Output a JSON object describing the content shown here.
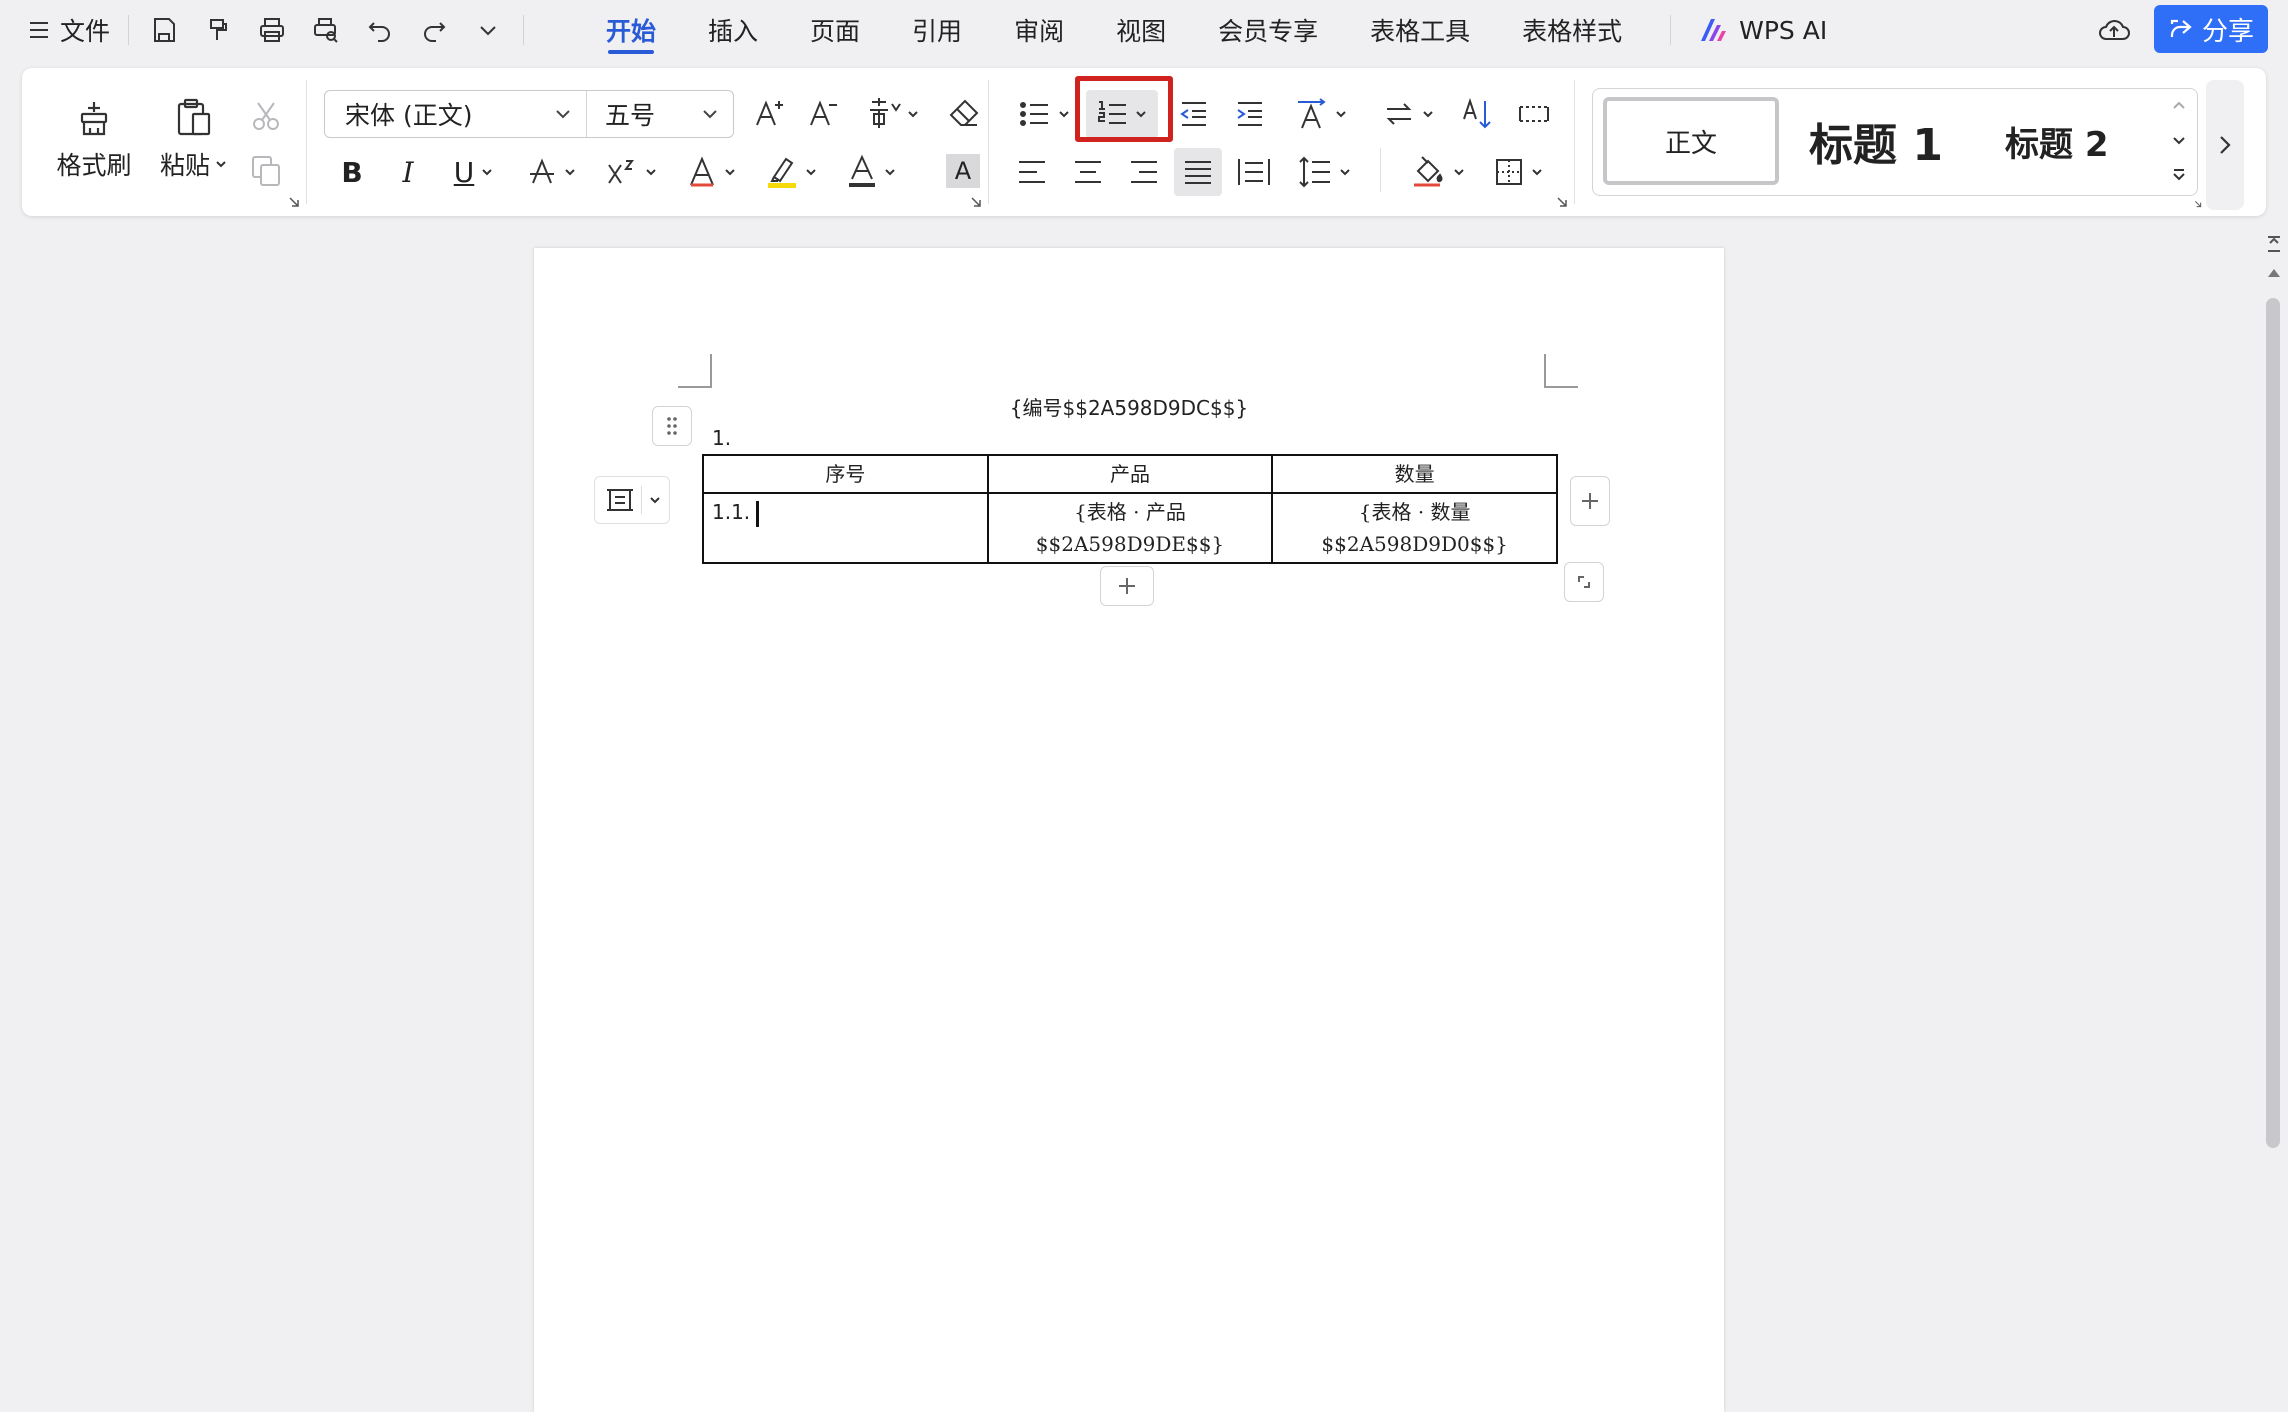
{
  "menubar": {
    "file_label": "文件",
    "tabs": [
      {
        "label": "开始",
        "active": true
      },
      {
        "label": "插入"
      },
      {
        "label": "页面"
      },
      {
        "label": "引用"
      },
      {
        "label": "审阅"
      },
      {
        "label": "视图"
      },
      {
        "label": "会员专享"
      },
      {
        "label": "表格工具"
      },
      {
        "label": "表格样式"
      }
    ],
    "ai_label": "WPS AI",
    "share_label": "分享"
  },
  "ribbon": {
    "format_painter": "格式刷",
    "paste": "粘贴",
    "font_name": "宋体 (正文)",
    "font_size": "五号",
    "bold": "B",
    "italic": "I",
    "underline": "U",
    "clear_format_char": "A",
    "styles": {
      "normal": "正文",
      "heading1": "标题 1",
      "heading2": "标题 2"
    }
  },
  "document": {
    "title": "{编号$$2A598D9DC$$}",
    "list_number": "1.",
    "table": {
      "headers": [
        "序号",
        "产品",
        "数量"
      ],
      "row": {
        "number": "1.1.",
        "product_line1": "{表格 · 产品",
        "product_line2": "$$2A598D9DE$$}",
        "qty_line1": "{表格 · 数量",
        "qty_line2": "$$2A598D9D0$$}"
      }
    }
  },
  "colors": {
    "accent": "#2a5bd7",
    "share": "#2f6ef6",
    "highlight_box": "#d0231f",
    "highlighter_yellow": "#f5d90a",
    "font_color_red": "#e34a3c"
  }
}
